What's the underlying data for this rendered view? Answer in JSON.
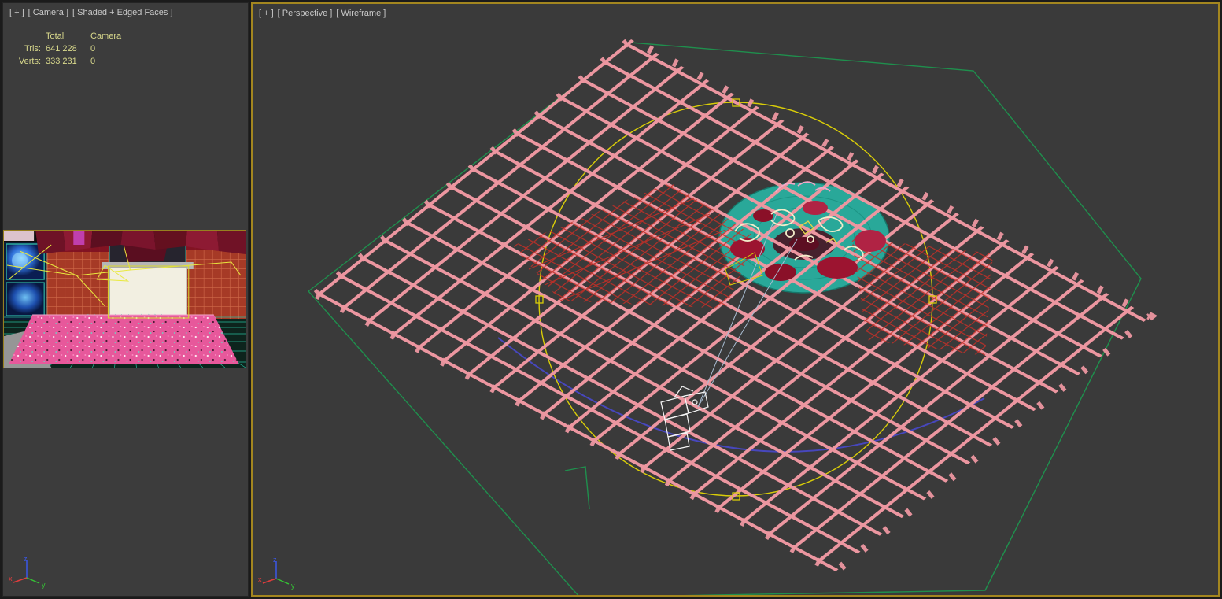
{
  "colors": {
    "viewport_bg": "#3c3c3c",
    "active_viewport_border": "#a3861f",
    "viewport_label_text": "#c9c9c9",
    "statistics_text": "#d9d98c",
    "lattice_pink": "#ec96a0",
    "ground_wire_green": "#1f8f4d",
    "gizmo_yellow": "#d9cd08",
    "trajectory_purple": "#4747bd",
    "torus_teal": "#28b2a2",
    "net_red": "#c23028",
    "camera_wire_white": "#f5f5f5"
  },
  "left_viewport": {
    "menus": {
      "general": "[ + ]",
      "pov": "[ Camera ]",
      "shading": "[ Shaded + Edged Faces ]"
    },
    "stats": {
      "columns": [
        "Total",
        "Camera"
      ],
      "rows": [
        {
          "label": "Tris:",
          "total": "641 228",
          "camera": "0"
        },
        {
          "label": "Verts:",
          "total": "333 231",
          "camera": "0"
        }
      ]
    },
    "axis": {
      "x": "x",
      "y": "y",
      "z": "z"
    }
  },
  "right_viewport": {
    "menus": {
      "general": "[ + ]",
      "pov": "[ Perspective ]",
      "shading": "[ Wireframe ]"
    },
    "axis": {
      "x": "x",
      "y": "y",
      "z": "z"
    }
  }
}
